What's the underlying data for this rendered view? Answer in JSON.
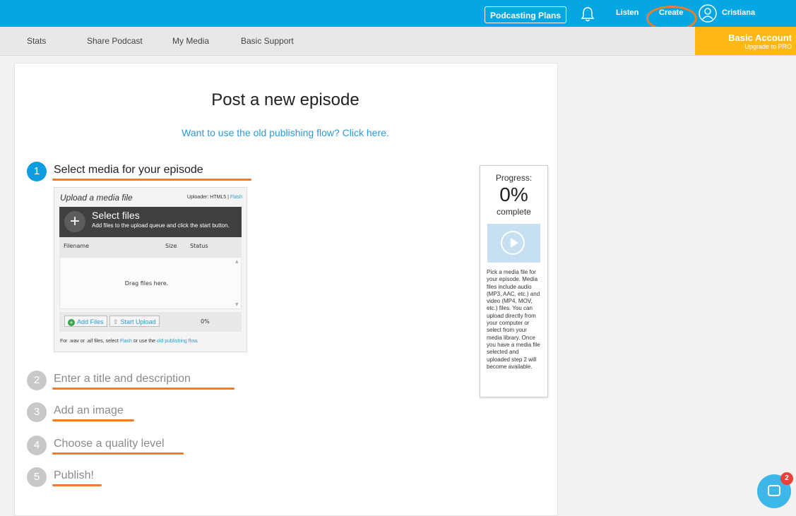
{
  "topbar": {
    "plans_label": "Podcasting Plans",
    "listen_label": "Listen",
    "create_label": "Create",
    "username": "Cristiana",
    "bell_icon": "bell-icon",
    "user_icon": "user-icon"
  },
  "subnav": {
    "items": [
      "Stats",
      "Share Podcast",
      "My Media",
      "Basic Support"
    ]
  },
  "account": {
    "title": "Basic Account",
    "subtitle": "Upgrade to PRO"
  },
  "main": {
    "title": "Post a new episode",
    "old_flow_link": "Want to use the old publishing flow? Click here.",
    "steps": [
      {
        "num": "1",
        "label": "Select media for your episode"
      },
      {
        "num": "2",
        "label": "Enter a title and description"
      },
      {
        "num": "3",
        "label": "Add an image"
      },
      {
        "num": "4",
        "label": "Choose a quality level"
      },
      {
        "num": "5",
        "label": "Publish!"
      }
    ]
  },
  "uploader": {
    "title": "Upload a media file",
    "type_prefix": "Uploader: HTML5 |",
    "type_link": "Flash",
    "select_title": "Select files",
    "select_sub": "Add files to the upload queue and click the start button.",
    "columns": [
      "Filename",
      "Size",
      "Status"
    ],
    "drag_text": "Drag files here.",
    "add_files": "Add Files",
    "start_upload": "Start Upload",
    "percent": "0%",
    "note_a": "For .wav or .aif files, select ",
    "note_flash": "Flash",
    "note_b": " or use the ",
    "note_link": "old publishing flow",
    "note_c": "."
  },
  "progress": {
    "label": "Progress:",
    "value": "0%",
    "complete": "complete",
    "help": "Pick a media file for your episode. Media files include audio (MP3, AAC, etc.) and video (MP4, MOV, etc.) files. You can upload directly from your computer or select from your media library. Once you have a media file selected and uploaded step 2 will become available."
  },
  "chat": {
    "badge": "2"
  },
  "colors": {
    "topbar": "#04a7e4",
    "accent_link": "#2a9ad6",
    "annotation_orange": "#f07d2c",
    "account_yellow": "#fdb813"
  }
}
